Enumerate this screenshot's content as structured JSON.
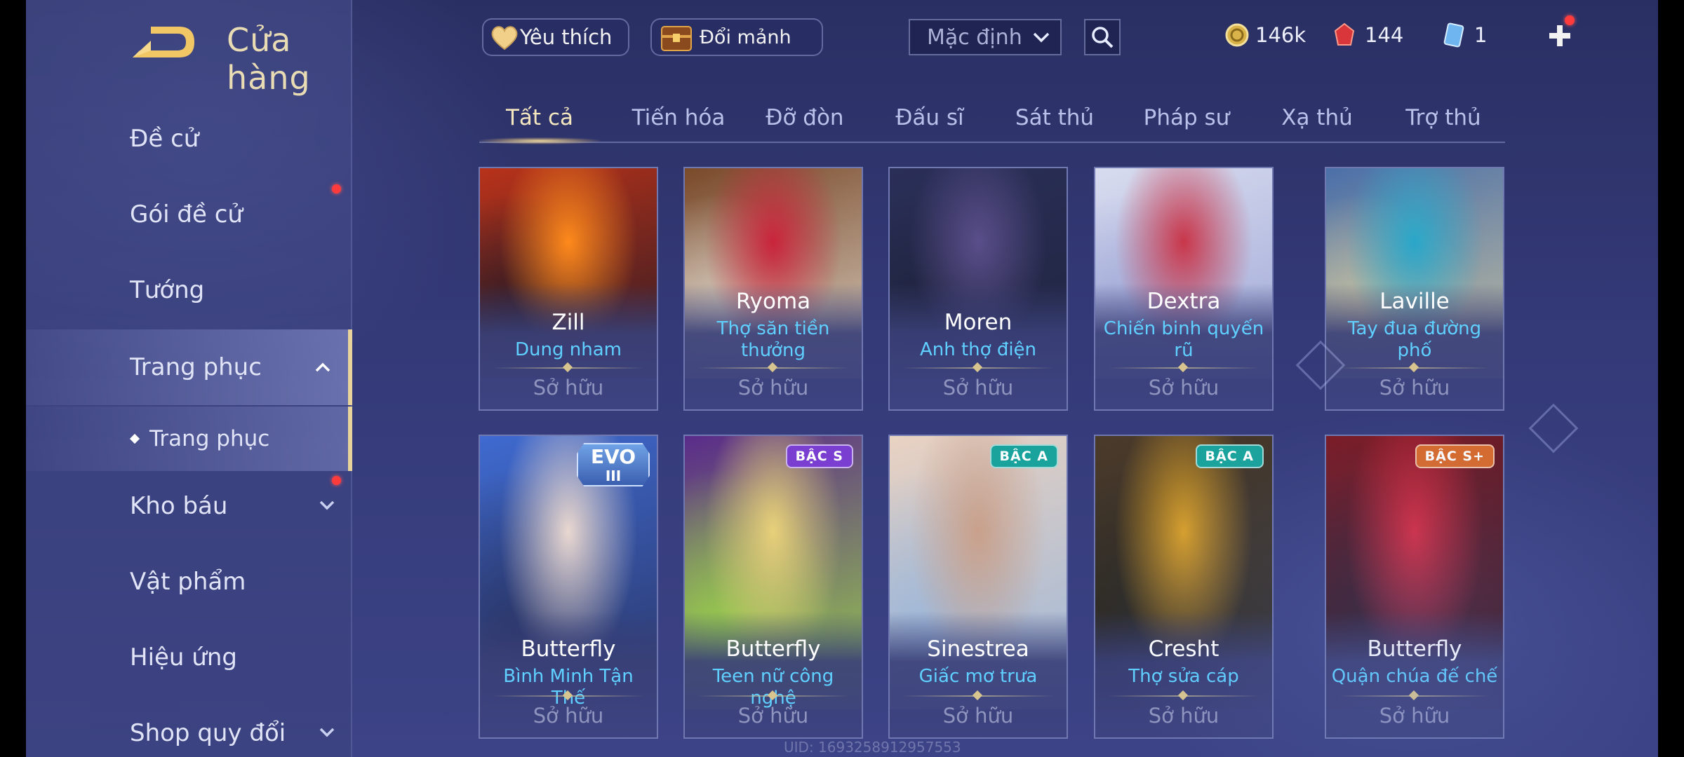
{
  "header": {
    "title": "Cửa hàng",
    "favorites_label": "Yêu thích",
    "exchange_label": "Đổi mảnh",
    "sort_value": "Mặc định"
  },
  "currencies": [
    {
      "icon": "gold-coin-icon",
      "value": "146k"
    },
    {
      "icon": "red-gem-icon",
      "value": "144"
    },
    {
      "icon": "voucher-card-icon",
      "value": "1"
    }
  ],
  "sidebar": {
    "items": [
      {
        "label": "Đề cử"
      },
      {
        "label": "Gói đề cử"
      },
      {
        "label": "Tướng"
      },
      {
        "label": "Trang phục"
      },
      {
        "label": "Trang phục"
      },
      {
        "label": "Kho báu"
      },
      {
        "label": "Vật phẩm"
      },
      {
        "label": "Hiệu ứng"
      },
      {
        "label": "Shop quy đổi"
      }
    ]
  },
  "tabs": [
    "Tất cả",
    "Tiến hóa",
    "Đỡ đòn",
    "Đấu sĩ",
    "Sát thủ",
    "Pháp sư",
    "Xạ thủ",
    "Trợ thủ"
  ],
  "cards": [
    {
      "hero": "Zill",
      "skin": "Dung nham",
      "status": "Sở hữu",
      "badge": "",
      "colors": [
        "#b8321a",
        "#ff8a1c",
        "#2a1a24"
      ]
    },
    {
      "hero": "Ryoma",
      "skin": "Thợ săn tiền thưởng",
      "status": "Sở hữu",
      "badge": "",
      "colors": [
        "#7a4a2a",
        "#c9243a",
        "#d9cfc2"
      ]
    },
    {
      "hero": "Moren",
      "skin": "Anh thợ điện",
      "status": "Sở hữu",
      "badge": "",
      "colors": [
        "#2a2f58",
        "#5a4e8a",
        "#20243f"
      ]
    },
    {
      "hero": "Dextra",
      "skin": "Chiến binh quyến rũ",
      "status": "Sở hữu",
      "badge": "",
      "colors": [
        "#d8dcef",
        "#c9364a",
        "#9ea6d6"
      ]
    },
    {
      "hero": "Laville",
      "skin": "Tay đua đường phố",
      "status": "Sở hữu",
      "badge": "",
      "colors": [
        "#4b6fa8",
        "#2aa7c9",
        "#c8c2a0"
      ]
    },
    {
      "hero": "Butterfly",
      "skin": "Bình Minh Tận Thế",
      "status": "Sở hữu",
      "badge": "EVO",
      "badge_sub": "III",
      "colors": [
        "#3f6ad0",
        "#e9d8d0",
        "#2a3566"
      ]
    },
    {
      "hero": "Butterfly",
      "skin": "Teen nữ công nghệ",
      "status": "Sở hữu",
      "badge": "BẬC S",
      "colors": [
        "#5a2b8a",
        "#e8d07a",
        "#9ad24a"
      ]
    },
    {
      "hero": "Sinestrea",
      "skin": "Giấc mơ trưa",
      "status": "Sở hữu",
      "badge": "BẬC A",
      "colors": [
        "#e9d2c2",
        "#c9a08a",
        "#9bb6d9"
      ]
    },
    {
      "hero": "Cresht",
      "skin": "Thợ sửa cáp",
      "status": "Sở hữu",
      "badge": "BẬC A",
      "colors": [
        "#4a3a2a",
        "#d9a02a",
        "#2a2a28"
      ]
    },
    {
      "hero": "Butterfly",
      "skin": "Quận chúa đế chế",
      "status": "Sở hữu",
      "badge": "BẬC S+",
      "colors": [
        "#7a1a24",
        "#d8283a",
        "#2a1622"
      ]
    }
  ],
  "badge_colors": {
    "BẬC S": "#7a3fd0",
    "BẬC A": "#1aa39c",
    "BẬC S+": "#d86a2a"
  },
  "footer": {
    "uid": "UID: 1693258912957553"
  }
}
